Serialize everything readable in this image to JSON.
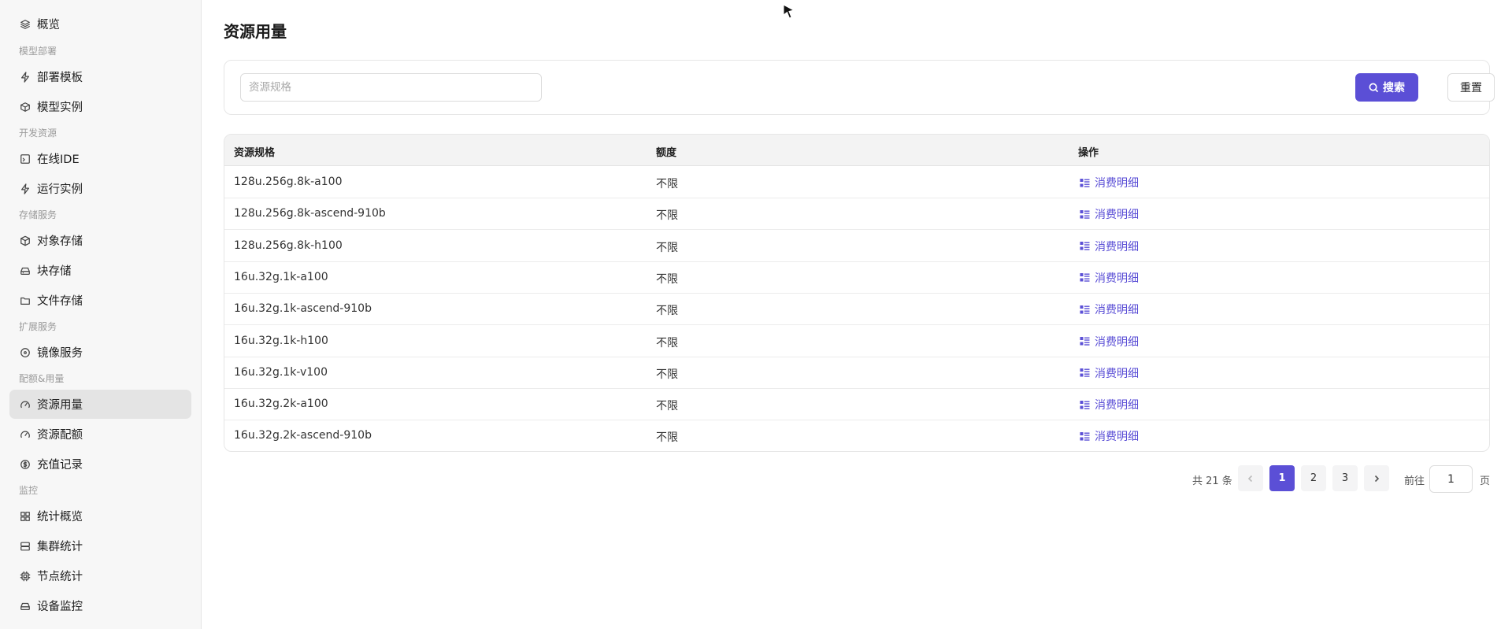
{
  "sidebar": {
    "items": [
      {
        "label": "概览",
        "icon": "layers-icon"
      },
      {
        "label": "部署模板",
        "icon": "bolt-icon"
      },
      {
        "label": "模型实例",
        "icon": "cube-stack-icon"
      },
      {
        "label": "在线IDE",
        "icon": "code-window-icon"
      },
      {
        "label": "运行实例",
        "icon": "bolt-icon"
      },
      {
        "label": "对象存储",
        "icon": "box-icon"
      },
      {
        "label": "块存储",
        "icon": "drive-icon"
      },
      {
        "label": "文件存储",
        "icon": "folder-icon"
      },
      {
        "label": "镜像服务",
        "icon": "disc-icon"
      },
      {
        "label": "资源用量",
        "icon": "gauge-icon"
      },
      {
        "label": "资源配额",
        "icon": "gauge-icon"
      },
      {
        "label": "充值记录",
        "icon": "dollar-circle-icon"
      },
      {
        "label": "统计概览",
        "icon": "grid-icon"
      },
      {
        "label": "集群统计",
        "icon": "server-icon"
      },
      {
        "label": "节点统计",
        "icon": "chip-icon"
      },
      {
        "label": "设备监控",
        "icon": "drive-icon"
      }
    ],
    "groups": [
      "模型部署",
      "开发资源",
      "存储服务",
      "扩展服务",
      "配额&用量",
      "监控"
    ],
    "active_label": "资源用量"
  },
  "main": {
    "title": "资源用量",
    "search": {
      "placeholder": "资源规格",
      "value": "",
      "search_label": "搜索",
      "reset_label": "重置"
    },
    "table": {
      "headers": [
        "资源规格",
        "额度",
        "操作"
      ],
      "rows": [
        {
          "spec": "128u.256g.8k-a100",
          "quota": "不限",
          "action": "消费明细"
        },
        {
          "spec": "128u.256g.8k-ascend-910b",
          "quota": "不限",
          "action": "消费明细"
        },
        {
          "spec": "128u.256g.8k-h100",
          "quota": "不限",
          "action": "消费明细"
        },
        {
          "spec": "16u.32g.1k-a100",
          "quota": "不限",
          "action": "消费明细"
        },
        {
          "spec": "16u.32g.1k-ascend-910b",
          "quota": "不限",
          "action": "消费明细"
        },
        {
          "spec": "16u.32g.1k-h100",
          "quota": "不限",
          "action": "消费明细"
        },
        {
          "spec": "16u.32g.1k-v100",
          "quota": "不限",
          "action": "消费明细"
        },
        {
          "spec": "16u.32g.2k-a100",
          "quota": "不限",
          "action": "消费明细"
        },
        {
          "spec": "16u.32g.2k-ascend-910b",
          "quota": "不限",
          "action": "消费明细"
        }
      ]
    },
    "pagination": {
      "total_text": "共 21 条",
      "pages": [
        "1",
        "2",
        "3"
      ],
      "current": "1",
      "goto_label": "前往",
      "goto_value": "1",
      "page_suffix": "页"
    }
  },
  "colors": {
    "accent": "#5b4fd6",
    "sidebar_bg": "#f7f7f7",
    "active_item_bg": "#e4e4e4"
  }
}
